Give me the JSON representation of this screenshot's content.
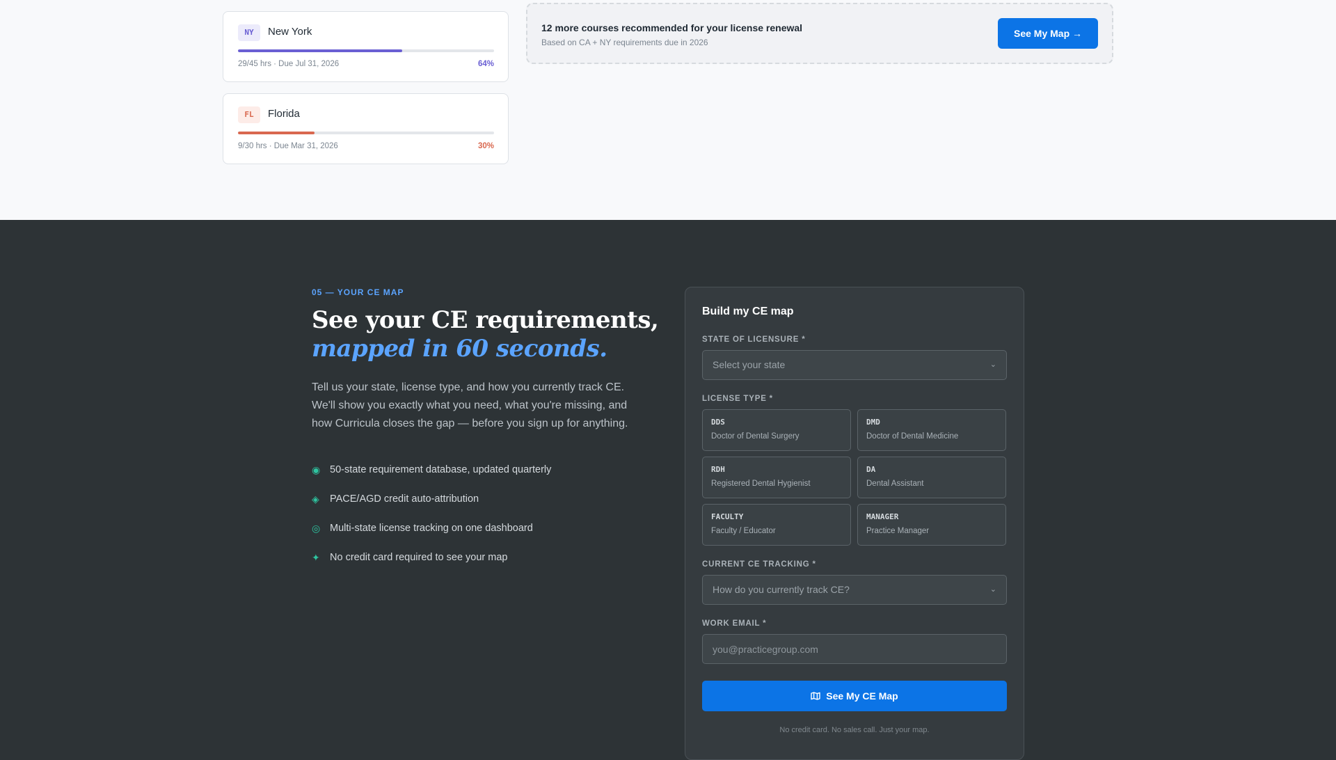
{
  "top": {
    "states": [
      {
        "code": "NY",
        "name": "New York",
        "meta": "29/45 hrs · Due Jul 31, 2026",
        "percent": "64%",
        "progress": 0.64
      },
      {
        "code": "FL",
        "name": "Florida",
        "meta": "9/30 hrs · Due Mar 31, 2026",
        "percent": "30%",
        "progress": 0.3
      }
    ],
    "recommendation": {
      "title": "12 more courses recommended for your license renewal",
      "subtitle": "Based on CA + NY requirements due in 2026",
      "button_label": "See My Map →"
    }
  },
  "hero": {
    "eyebrow": "05 — YOUR CE MAP",
    "headline": "See your CE requirements,",
    "headline_accent": "mapped in 60 seconds.",
    "intro": "Tell us your state, license type, and how you currently track CE. We'll show you exactly what you need, what you're missing, and how Curricula closes the gap — before you sign up for anything.",
    "features": [
      {
        "icon": "◉",
        "text": "50-state requirement database, updated quarterly"
      },
      {
        "icon": "◈",
        "text": "PACE/AGD credit auto-attribution"
      },
      {
        "icon": "◎",
        "text": "Multi-state license tracking on one dashboard"
      },
      {
        "icon": "✦",
        "text": "No credit card required to see your map"
      }
    ]
  },
  "form": {
    "title": "Build my CE map",
    "state_label": "STATE OF LICENSURE *",
    "state_placeholder": "Select your state",
    "license_label": "LICENSE TYPE *",
    "license_types": [
      {
        "code": "DDS",
        "desc": "Doctor of Dental Surgery"
      },
      {
        "code": "DMD",
        "desc": "Doctor of Dental Medicine"
      },
      {
        "code": "RDH",
        "desc": "Registered Dental Hygienist"
      },
      {
        "code": "DA",
        "desc": "Dental Assistant"
      },
      {
        "code": "FACULTY",
        "desc": "Faculty / Educator"
      },
      {
        "code": "MANAGER",
        "desc": "Practice Manager"
      }
    ],
    "tracking_label": "CURRENT CE TRACKING *",
    "tracking_placeholder": "How do you currently track CE?",
    "email_label": "WORK EMAIL *",
    "email_placeholder": "you@practicegroup.com",
    "submit_label": "See My CE Map",
    "note": "No credit card. No sales call. Just your map."
  },
  "colors": {
    "accent": "#0c74e6",
    "dark_bg": "#2d3336",
    "ny": "#6a5fd3",
    "fl": "#d9684f",
    "feature_icon": "#2ec4a0"
  }
}
